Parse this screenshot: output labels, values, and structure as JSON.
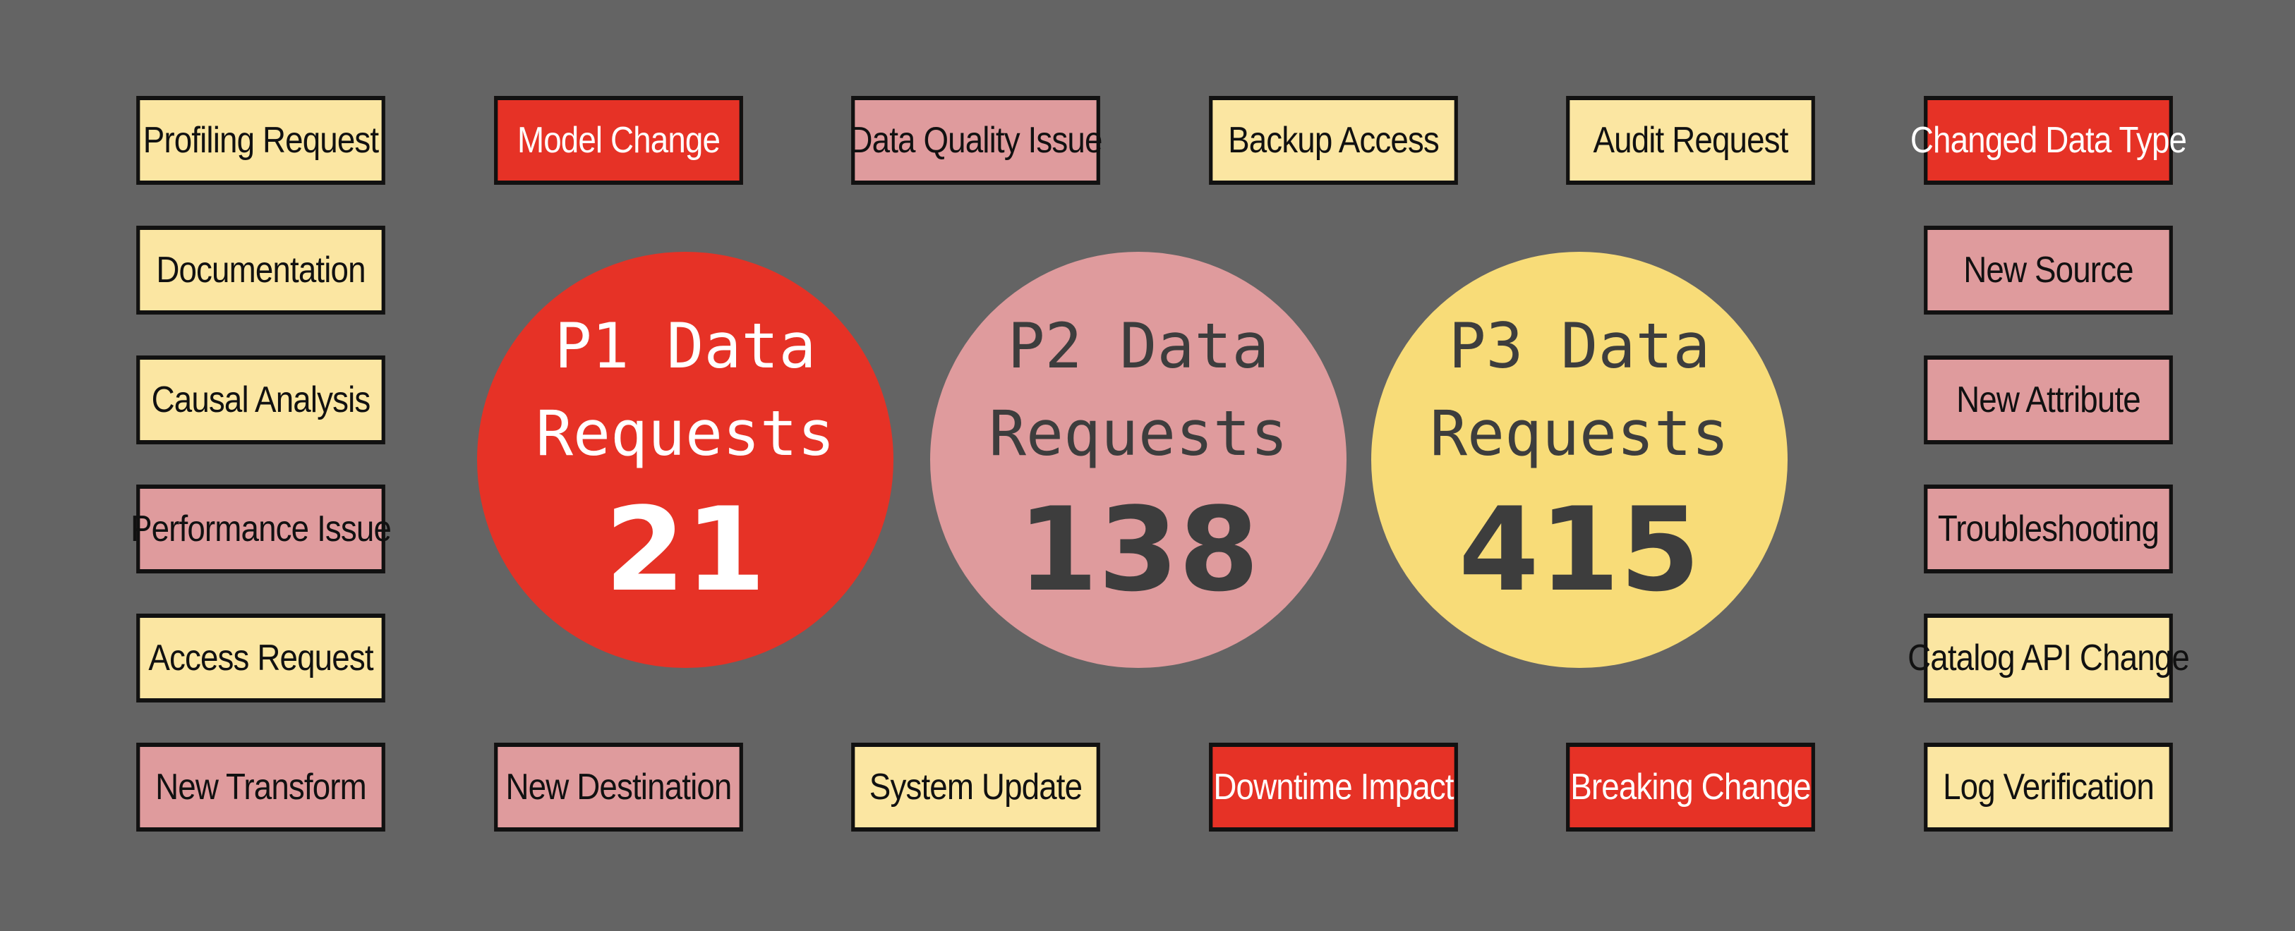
{
  "colors": {
    "background": "#646464",
    "p1": "#e63226",
    "p2": "#df9b9d",
    "p3": "#fbe6a2",
    "p3_circle": "#f8dc78",
    "border": "#111111"
  },
  "circles": [
    {
      "line1": "P1 Data",
      "line2": "Requests",
      "count": "21"
    },
    {
      "line1": "P2 Data",
      "line2": "Requests",
      "count": "138"
    },
    {
      "line1": "P3 Data",
      "line2": "Requests",
      "count": "415"
    }
  ],
  "top_row": [
    {
      "label": "Profiling Request",
      "priority": "p3"
    },
    {
      "label": "Model Change",
      "priority": "p1"
    },
    {
      "label": "Data Quality Issue",
      "priority": "p2"
    },
    {
      "label": "Backup Access",
      "priority": "p3"
    },
    {
      "label": "Audit Request",
      "priority": "p3"
    },
    {
      "label": "Changed Data Type",
      "priority": "p1"
    }
  ],
  "left_column": [
    {
      "label": "Documentation",
      "priority": "p3"
    },
    {
      "label": "Causal Analysis",
      "priority": "p3"
    },
    {
      "label": "Performance Issue",
      "priority": "p2"
    },
    {
      "label": "Access Request",
      "priority": "p3"
    }
  ],
  "right_column": [
    {
      "label": "New Source",
      "priority": "p2"
    },
    {
      "label": "New Attribute",
      "priority": "p2"
    },
    {
      "label": "Troubleshooting",
      "priority": "p2"
    },
    {
      "label": "Catalog API Change",
      "priority": "p3"
    }
  ],
  "bottom_row": [
    {
      "label": "New Transform",
      "priority": "p2"
    },
    {
      "label": "New Destination",
      "priority": "p2"
    },
    {
      "label": "System Update",
      "priority": "p3"
    },
    {
      "label": "Downtime Impact",
      "priority": "p1"
    },
    {
      "label": "Breaking Change",
      "priority": "p1"
    },
    {
      "label": "Log Verification",
      "priority": "p3"
    }
  ]
}
